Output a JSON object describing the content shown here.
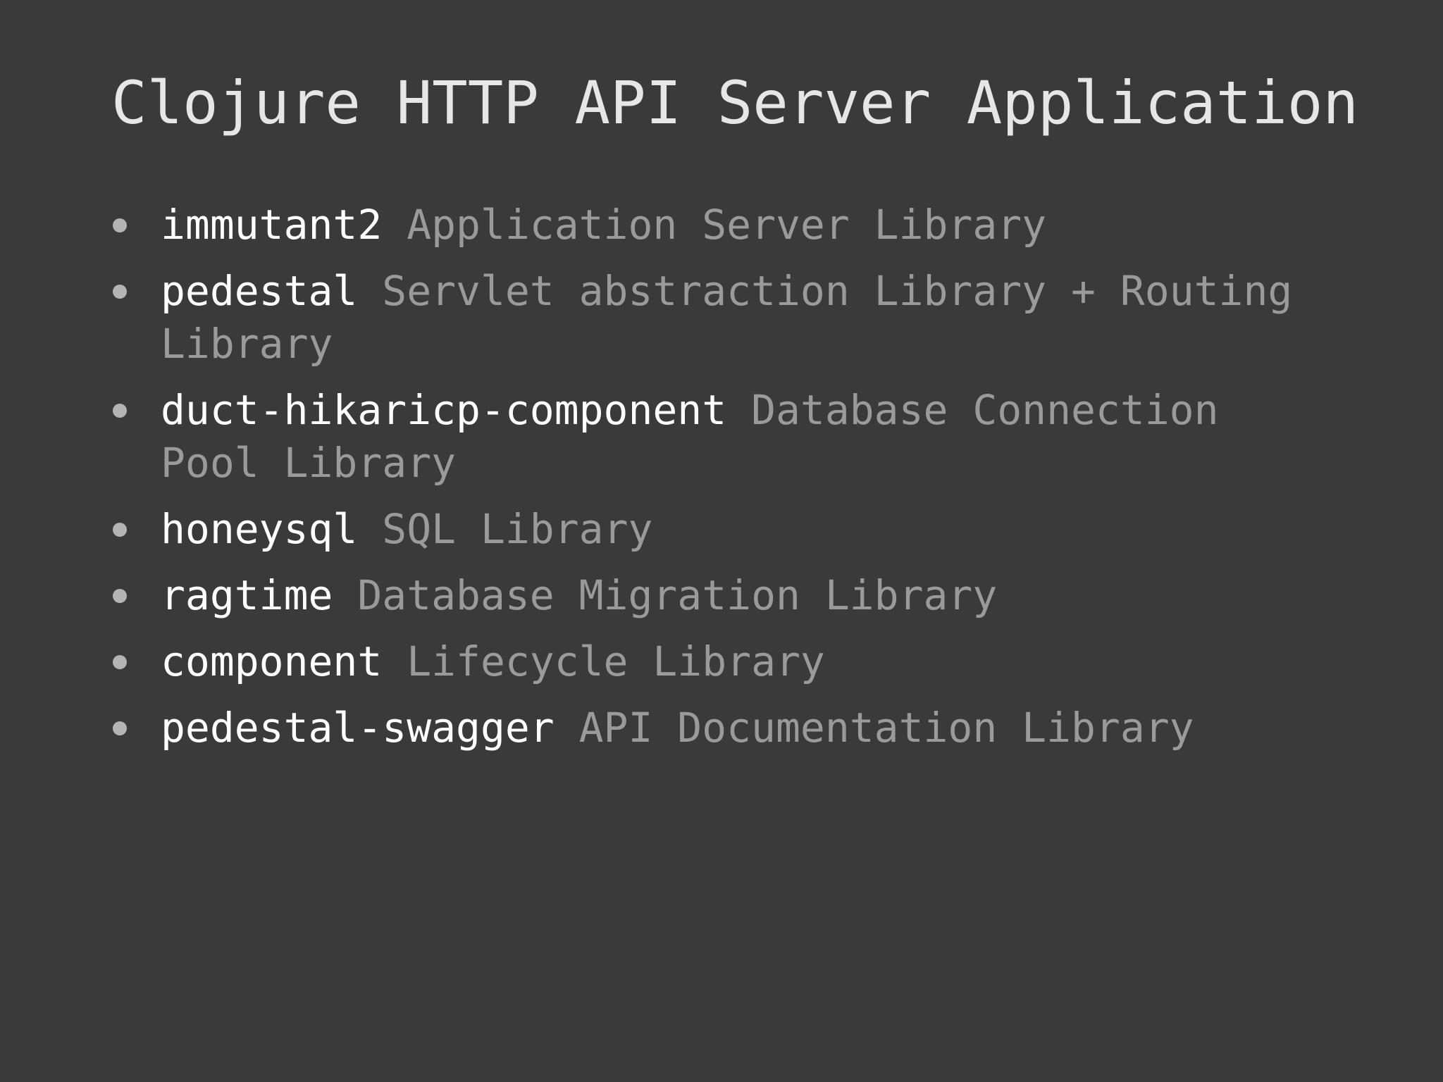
{
  "colors": {
    "background": "#3a3a3a",
    "title": "#e6e6e6",
    "library_name": "#ffffff",
    "library_description": "#9a9a9a",
    "bullet": "#b4b4b4"
  },
  "title": "Clojure HTTP API Server Application",
  "items": [
    {
      "name": "immutant2",
      "description": "Application Server Library"
    },
    {
      "name": "pedestal",
      "description": "Servlet abstraction Library + Routing Library"
    },
    {
      "name": "duct-hikaricp-component",
      "description": "Database Connection Pool Library"
    },
    {
      "name": "honeysql",
      "description": "SQL Library"
    },
    {
      "name": "ragtime",
      "description": "Database Migration Library"
    },
    {
      "name": "component",
      "description": "Lifecycle Library"
    },
    {
      "name": "pedestal-swagger",
      "description": "API Documentation Library"
    }
  ]
}
